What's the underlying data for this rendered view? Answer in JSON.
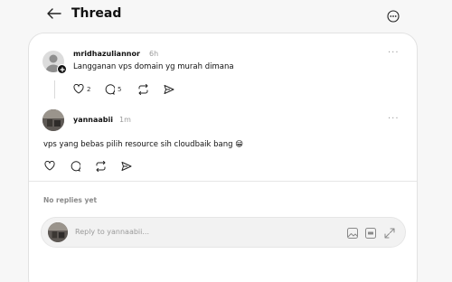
{
  "header": {
    "title": "Thread"
  },
  "original_post": {
    "username": "mridhazuliannor",
    "time": "6h",
    "text": "Langganan vps domain yg murah dimana",
    "like_count": "2",
    "comment_count": "5",
    "more": "···"
  },
  "reply_post": {
    "username": "yannaabii",
    "time": "1m",
    "text": "vps yang bebas pilih resource sih cloudbaik bang 😁",
    "more": "···"
  },
  "replies_section": {
    "empty_text": "No replies yet"
  },
  "reply_composer": {
    "placeholder": "Reply to yannaabii..."
  },
  "icons": [
    "back-arrow-icon",
    "more-circle-icon",
    "heart-icon",
    "comment-icon",
    "repost-icon",
    "share-icon",
    "image-icon",
    "gif-icon",
    "expand-icon"
  ]
}
